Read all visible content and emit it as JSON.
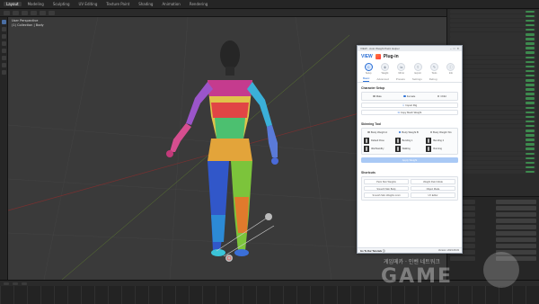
{
  "topbar": {
    "workspaces": [
      "Layout",
      "Modeling",
      "Sculpting",
      "UV Editing",
      "Texture Paint",
      "Shading",
      "Animation",
      "Rendering"
    ]
  },
  "viewport": {
    "overlay_title": "User Perspective",
    "overlay_sub": "(1) Collection | Body"
  },
  "plugin": {
    "window_title": "VIEW - Auto Weight Paint Helper",
    "brand_name": "VIEW",
    "brand_suffix": "Plug-in",
    "modes": [
      {
        "label": "Setup",
        "icon": "person-icon",
        "glyph": "☺"
      },
      {
        "label": "Weight",
        "icon": "drop-icon",
        "glyph": "◈"
      },
      {
        "label": "Mirror",
        "icon": "mirror-icon",
        "glyph": "⇋"
      },
      {
        "label": "Export",
        "icon": "export-icon",
        "glyph": "⇪"
      },
      {
        "label": "Tools",
        "icon": "tool-icon",
        "glyph": "✎"
      },
      {
        "label": "Info",
        "icon": "info-icon",
        "glyph": "ⓘ"
      }
    ],
    "tabs": [
      "Basic",
      "Advanced",
      "Presets",
      "Settings",
      "Debug"
    ],
    "character_setup": {
      "title": "Character Setup",
      "options": [
        "Male",
        "Female",
        "Child"
      ],
      "selected": 1,
      "buttons": [
        "Import Rig",
        "Copy Mesh Weight"
      ]
    },
    "skinning_tool": {
      "title": "Skinning Tool",
      "options": [
        "Body Weight A",
        "Body Weight B",
        "Body Weight SG"
      ],
      "selected": 1,
      "poses": [
        "Default Pose",
        "Bending 1",
        "Bending 2",
        "Idle/Standby",
        "Walking",
        "Running"
      ],
      "apply_label": "Apply Weight"
    },
    "shortcuts": {
      "title": "Shortcuts",
      "items": [
        "Paint Skin Weights",
        "Weight Paint Mode",
        "Smooth Skin Body",
        "Object Mode",
        "Smooth Skin Weights Limit",
        "UV Editor"
      ]
    },
    "footer": {
      "left": "Go To Our Tutorials",
      "right": "Version: 2023.08.03"
    }
  },
  "watermark": {
    "text": "게임메카 · 인벤 네트워크",
    "logo": "GAME"
  }
}
